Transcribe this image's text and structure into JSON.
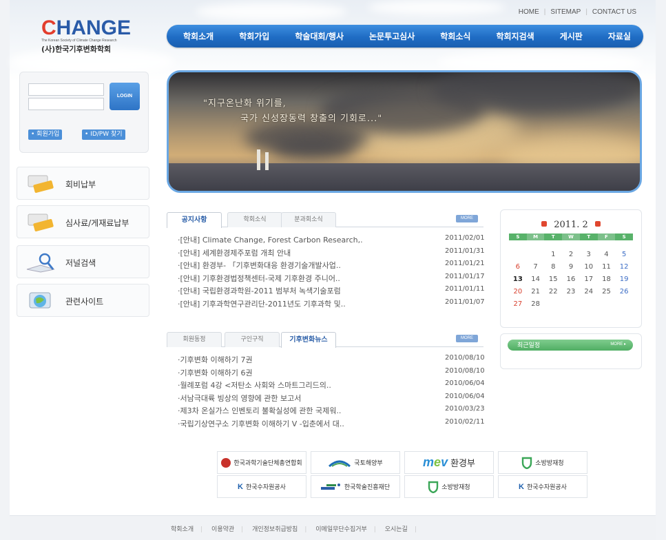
{
  "util_nav": [
    "HOME",
    "SITEMAP",
    "CONTACT US"
  ],
  "logo": {
    "word_c": "C",
    "word_rest": "HANGE",
    "english": "The Korean Society of Climate Change Research",
    "korean": "(사)한국기후변화학회"
  },
  "gnb": [
    "학회소개",
    "학회가입",
    "학술대회/행사",
    "논문투고심사",
    "학회소식",
    "학회지검색",
    "게시판",
    "자료실"
  ],
  "login": {
    "button": "LOGIN",
    "join": "• 회원가입",
    "find": "• ID/PW 찾기"
  },
  "left_menu": [
    {
      "label": "회비납부",
      "icon": "card-payment-icon"
    },
    {
      "label": "심사료/게재료납부",
      "icon": "card-payment-icon"
    },
    {
      "label": "저널검색",
      "icon": "magnifier-search-icon"
    },
    {
      "label": "관련사이트",
      "icon": "globe-icon"
    }
  ],
  "banner": {
    "line1": "\"지구온난화 위기를,",
    "line2": "국가 신성장동력 창출의 기회로...\""
  },
  "notice": {
    "tabs": [
      "공지사항",
      "학회소식",
      "분과회소식"
    ],
    "active": 0,
    "more": "MORE",
    "items": [
      {
        "title": "·[안내] Climate Change, Forest Carbon Research,.",
        "date": "2011/02/01"
      },
      {
        "title": "·[안내] 세계환경제주포럼 개최 안내",
        "date": "2011/01/31"
      },
      {
        "title": "·[안내] 환경부- 「기후변화대응 환경기술개발사업..",
        "date": "2011/01/21"
      },
      {
        "title": "·[안내] 기후환경법정책센터-국제 기후환경 주니어..",
        "date": "2011/01/17"
      },
      {
        "title": "·[안내] 국립환경과학원-2011 범부처 녹색기술포럼",
        "date": "2011/01/11"
      },
      {
        "title": "·[안내] 기후과학연구관리단-2011년도 기후과학 및..",
        "date": "2011/01/07"
      }
    ]
  },
  "news": {
    "tabs": [
      "회원동정",
      "구인구직",
      "기후변화뉴스"
    ],
    "active": 2,
    "more": "MORE",
    "items": [
      {
        "title": "·기후변화 이해하기 7권",
        "date": "2010/08/10"
      },
      {
        "title": "·기후변화 이해하기 6권",
        "date": "2010/08/10"
      },
      {
        "title": "·월례포럼 4강 <저탄소 사회와 스마트그리드의..",
        "date": "2010/06/04"
      },
      {
        "title": "·서남극대륙 빙상의 영향에 관한 보고서",
        "date": "2010/06/04"
      },
      {
        "title": "·제3차 온실가스 인벤토리 불확실성에 관한 국제워..",
        "date": "2010/03/23"
      },
      {
        "title": "·국립기상연구소 기후변화 이해하기 V -입춘에서 대..",
        "date": "2010/02/11"
      }
    ]
  },
  "calendar": {
    "title": "2011. 2",
    "dow": [
      "S",
      "M",
      "T",
      "W",
      "T",
      "F",
      "S"
    ],
    "weeks": [
      [
        "",
        "",
        "1",
        "2",
        "3",
        "4",
        "5"
      ],
      [
        "6",
        "7",
        "8",
        "9",
        "10",
        "11",
        "12"
      ],
      [
        "13",
        "14",
        "15",
        "16",
        "17",
        "18",
        "19"
      ],
      [
        "20",
        "21",
        "22",
        "23",
        "24",
        "25",
        "26"
      ],
      [
        "27",
        "28",
        "",
        "",
        "",
        "",
        ""
      ]
    ],
    "today": "13",
    "colors": {
      "green": "#58b26a",
      "red": "#e0472f"
    }
  },
  "recent": {
    "title": "최근일정",
    "more": "MORE ▸"
  },
  "partners": [
    {
      "name": "한국과학기술단체총연합회",
      "icon": "kofst-logo-icon",
      "kind": "dot",
      "color": "#c8322b"
    },
    {
      "name": "국토해양부",
      "icon": "mltm-logo-icon",
      "kind": "arc",
      "color": "#1d6fb8"
    },
    {
      "name": "환경부",
      "icon": "me-logo-icon",
      "kind": "mev",
      "color": "#2a8fd6"
    },
    {
      "name": "소방방재청",
      "icon": "nema-shield-icon",
      "kind": "shield",
      "color": "#3aa657"
    },
    {
      "name": "한국수자원공사",
      "icon": "kwater-logo-icon",
      "kind": "kw",
      "color": "#1d5fad"
    },
    {
      "name": "한국학술진흥재단",
      "icon": "krf-logo-icon",
      "kind": "bars",
      "color": "#2d8a4a"
    },
    {
      "name": "소방방재청",
      "icon": "nema-shield-icon",
      "kind": "shield",
      "color": "#3aa657"
    },
    {
      "name": "한국수자원공사",
      "icon": "kwater-logo-icon",
      "kind": "kw",
      "color": "#1d5fad"
    }
  ],
  "footer": [
    "학회소개",
    "이용약관",
    "개인정보취급방침",
    "이메일무단수집거부",
    "오시는길"
  ]
}
